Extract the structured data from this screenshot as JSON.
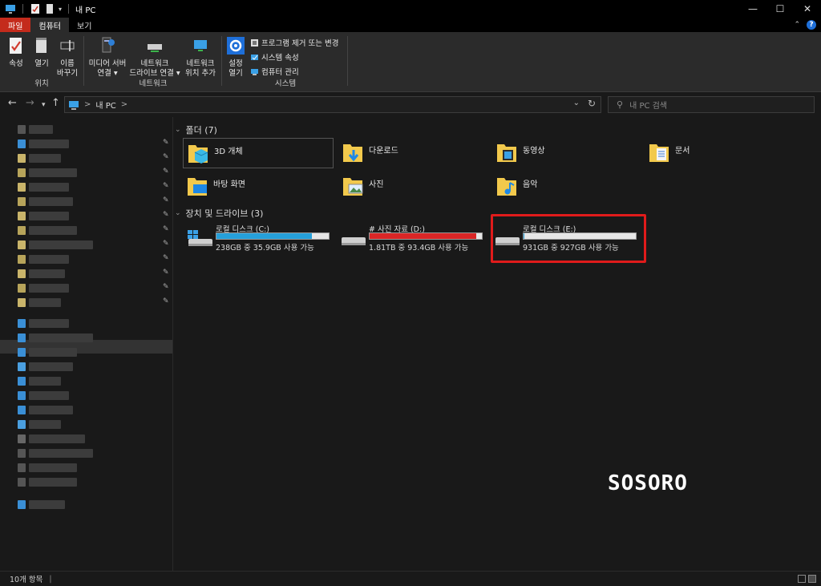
{
  "window": {
    "title": "내 PC"
  },
  "ribbon_tabs": [
    {
      "label": "파일"
    },
    {
      "label": "컴퓨터"
    },
    {
      "label": "보기"
    }
  ],
  "ribbon": {
    "location": {
      "label": "위치",
      "properties": "속성",
      "open": "열기",
      "rename_1": "이름",
      "rename_2": "바꾸기"
    },
    "network": {
      "label": "네트워크",
      "media_1": "미디어 서버",
      "media_2": "연결 ▾",
      "map_1": "네트워크",
      "map_2": "드라이브 연결 ▾",
      "add_1": "네트워크",
      "add_2": "위치 추가"
    },
    "system": {
      "label": "시스템",
      "settings_1": "설정",
      "settings_2": "열기",
      "uninstall": "프로그램 제거 또는 변경",
      "sys_props": "시스템 속성",
      "manage": "컴퓨터 관리"
    }
  },
  "address": {
    "path": "내 PC",
    "separator": ">"
  },
  "search": {
    "placeholder": "내 PC 검색"
  },
  "folders": {
    "header": "폴더 (7)",
    "items": [
      "3D 개체",
      "다운로드",
      "동영상",
      "문서",
      "바탕 화면",
      "사진",
      "음악"
    ]
  },
  "drives": {
    "header": "장치 및 드라이브 (3)",
    "items": [
      {
        "name": "로컬 디스크 (C:)",
        "free": "238GB 중 35.9GB 사용 가능",
        "used_fraction": 0.85,
        "bar_color": "#26a0da"
      },
      {
        "name": "# 사진 자료 (D:)",
        "free": "1.81TB 중 93.4GB 사용 가능",
        "used_fraction": 0.95,
        "bar_color": "#da2626"
      },
      {
        "name": "로컬 디스크 (E:)",
        "free": "931GB 중 927GB 사용 가능",
        "used_fraction": 0.005,
        "bar_color": "#26a0da"
      }
    ]
  },
  "watermark": "SOSORO",
  "status": {
    "count": "10개 항목"
  },
  "colors": {
    "accent": "#1e6fd9",
    "file_tab": "#c42b1c",
    "highlight": "#e01b1b"
  }
}
